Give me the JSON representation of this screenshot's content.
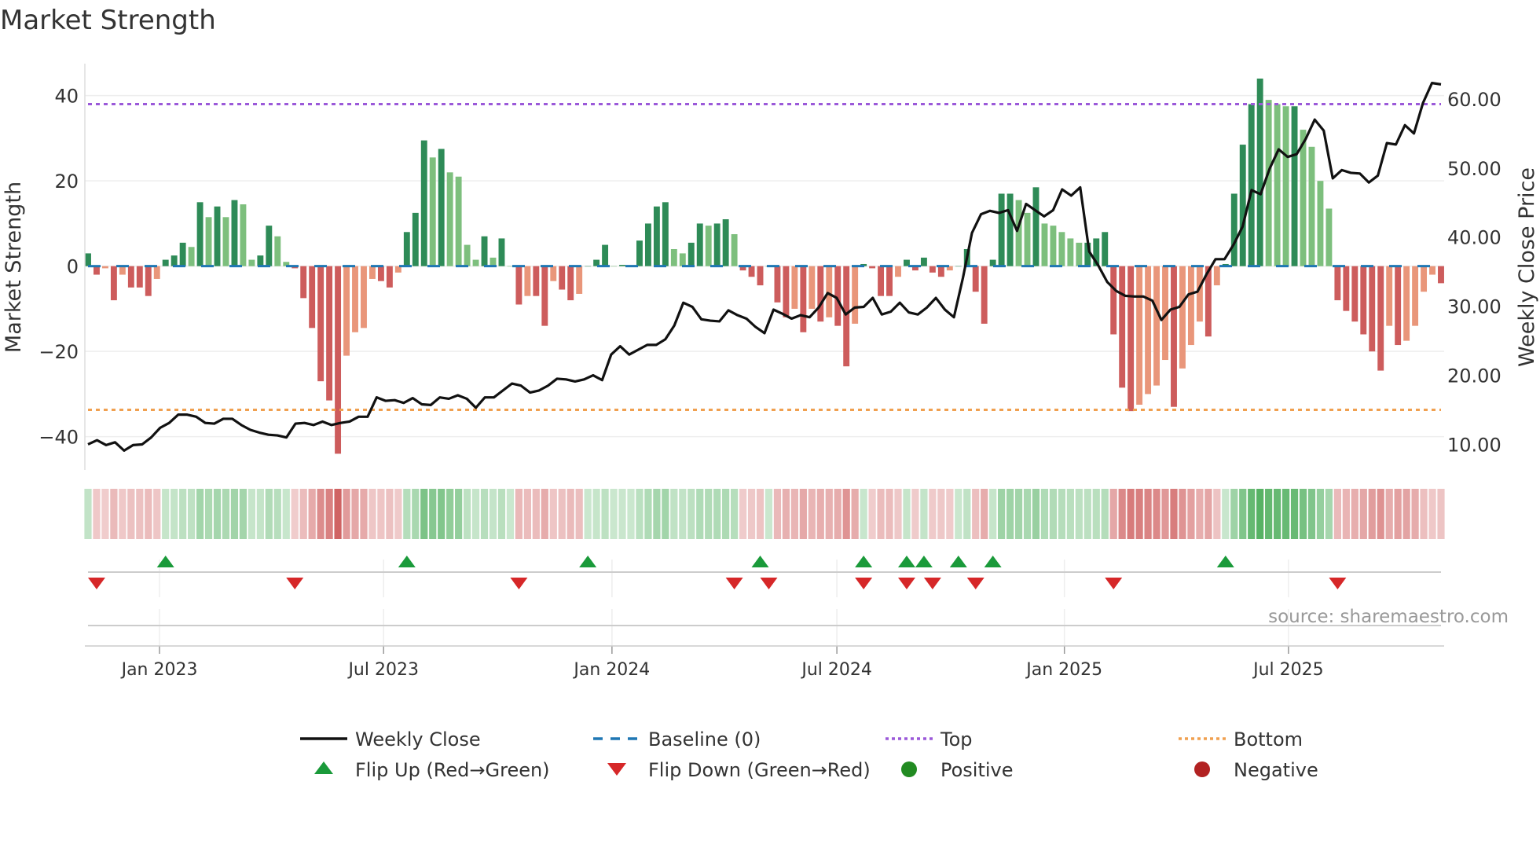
{
  "chart_data": {
    "type": "bar",
    "title": "Market Strength",
    "ylabel": "Market Strength",
    "y2label": "Weekly Close Price",
    "ylim": [
      -47.8,
      47.5
    ],
    "y2lim": [
      6.3,
      65.1
    ],
    "yticks": [
      40,
      20,
      0,
      -20,
      -40
    ],
    "ytick_labels": [
      "40",
      "20",
      "0",
      "−20",
      "−40"
    ],
    "y2ticks": [
      60,
      50,
      40,
      30,
      20,
      10
    ],
    "y2tick_labels": [
      "60.00",
      "50.00",
      "40.00",
      "30.00",
      "20.00",
      "10.00"
    ],
    "x_start_week": 0,
    "xticks": [
      {
        "week": 8.3,
        "label": "Jan 2023"
      },
      {
        "week": 34.3,
        "label": "Jul 2023"
      },
      {
        "week": 60.8,
        "label": "Jan 2024"
      },
      {
        "week": 86.9,
        "label": "Jul 2024"
      },
      {
        "week": 113.3,
        "label": "Jan 2025"
      },
      {
        "week": 139.3,
        "label": "Jul 2025"
      }
    ],
    "top_level": 38,
    "bottom_level": -33.7,
    "baseline": 0,
    "strength": [
      3,
      -2,
      -0.5,
      -8,
      -2,
      -5,
      -5,
      -7,
      -3,
      1.5,
      2.5,
      5.5,
      4.5,
      15,
      11.5,
      14,
      11.5,
      15.5,
      14.5,
      1.5,
      2.5,
      9.5,
      7,
      1,
      -0.5,
      -7.5,
      -14.5,
      -27,
      -31.5,
      -44,
      -21,
      -15.5,
      -14.5,
      -3,
      -3.5,
      -5,
      -1.5,
      8,
      12.5,
      29.5,
      25.5,
      27.5,
      22,
      21,
      5,
      1.5,
      7,
      2,
      6.5,
      0,
      -9,
      -7,
      -7,
      -14,
      -3.5,
      -5.5,
      -8,
      -6.5,
      0,
      1.5,
      5,
      0,
      0.3,
      0,
      6,
      10,
      14,
      15,
      4,
      3,
      5.5,
      10,
      9.5,
      10,
      11,
      7.5,
      -1,
      -2.5,
      -4.5,
      0,
      -8.5,
      -12,
      -10,
      -15.5,
      -10,
      -13,
      -12,
      -14,
      -23.5,
      -13.5,
      0.5,
      -0.5,
      -7,
      -7,
      -2.5,
      1.5,
      -1,
      2,
      -1.5,
      -2.5,
      -1,
      0,
      4,
      -6,
      -13.5,
      1.5,
      17,
      17,
      15.5,
      12.5,
      18.5,
      10,
      9.5,
      8,
      6.5,
      5.5,
      5.5,
      6.5,
      8,
      -16,
      -28.5,
      -34,
      -32.5,
      -30,
      -28,
      -22,
      -33,
      -24,
      -18.5,
      -13,
      -16.5,
      -4.5,
      0.5,
      17,
      28.5,
      38,
      44,
      39,
      38,
      37.5,
      37.5,
      32,
      28,
      20,
      13.5,
      -8,
      -10.5,
      -13,
      -16,
      -20,
      -24.5,
      -14,
      -18.5,
      -17.5,
      -14,
      -6,
      -2,
      -4
    ],
    "weekly_close": [
      10.0,
      10.6,
      9.9,
      10.3,
      9.1,
      9.9,
      10.0,
      11.0,
      12.4,
      13.1,
      14.3,
      14.3,
      14.0,
      13.1,
      13.0,
      13.7,
      13.7,
      12.8,
      12.1,
      11.7,
      11.4,
      11.3,
      11.0,
      13.0,
      13.1,
      12.8,
      13.3,
      12.8,
      13.1,
      13.3,
      14.0,
      14.0,
      16.8,
      16.3,
      16.4,
      16.0,
      16.7,
      15.8,
      15.7,
      16.8,
      16.6,
      17.1,
      16.6,
      15.3,
      16.8,
      16.8,
      17.8,
      18.8,
      18.5,
      17.5,
      17.8,
      18.5,
      19.5,
      19.4,
      19.1,
      19.4,
      20.0,
      19.3,
      23.0,
      24.2,
      23.0,
      23.7,
      24.4,
      24.4,
      25.2,
      27.2,
      30.5,
      29.9,
      28.1,
      27.9,
      27.8,
      29.4,
      28.7,
      28.2,
      27.0,
      26.1,
      29.5,
      28.9,
      28.2,
      28.7,
      28.4,
      29.8,
      31.9,
      31.2,
      28.8,
      29.8,
      29.9,
      31.2,
      28.8,
      29.2,
      30.5,
      29.1,
      28.8,
      29.8,
      31.2,
      29.5,
      28.4,
      34.1,
      40.6,
      43.3,
      43.8,
      43.5,
      43.9,
      40.9,
      44.8,
      43.9,
      43.0,
      43.9,
      46.9,
      46.0,
      47.2,
      37.9,
      35.9,
      33.5,
      32.2,
      31.5,
      31.4,
      31.4,
      30.8,
      28.0,
      29.5,
      29.9,
      31.7,
      32.1,
      34.6,
      36.8,
      36.8,
      38.9,
      41.5,
      46.8,
      46.2,
      49.9,
      52.7,
      51.6,
      52.0,
      54.2,
      57.0,
      55.4,
      48.5,
      49.7,
      49.3,
      49.2,
      47.9,
      48.9,
      53.6,
      53.4,
      56.2,
      55.0,
      59.4,
      62.3,
      62.1
    ],
    "flip_up_weeks": [
      9,
      37,
      58,
      78,
      90,
      95,
      97,
      101,
      105,
      132
    ],
    "flip_down_weeks": [
      1,
      24,
      50,
      75,
      79,
      90,
      95,
      98,
      103,
      119,
      145
    ],
    "legend_placement": "bottom",
    "legend": [
      "Weekly Close",
      "Baseline (0)",
      "Top",
      "Bottom",
      "Flip Up (Red→Green)",
      "Flip Down (Green→Red)",
      "Positive",
      "Negative"
    ],
    "source": "source: sharemaestro.com"
  },
  "colors": {
    "up_rising": "#2e8b57",
    "up_falling": "#7dbf7d",
    "down_falling": "#cd5c5c",
    "down_rising": "#e9967a",
    "baseline": "#1f77b4",
    "top": "#9b59d9",
    "bottom": "#f0a050",
    "flip_up": "#1a9a3a",
    "flip_down": "#d62728",
    "positive": "#228b22",
    "negative": "#b22222"
  }
}
